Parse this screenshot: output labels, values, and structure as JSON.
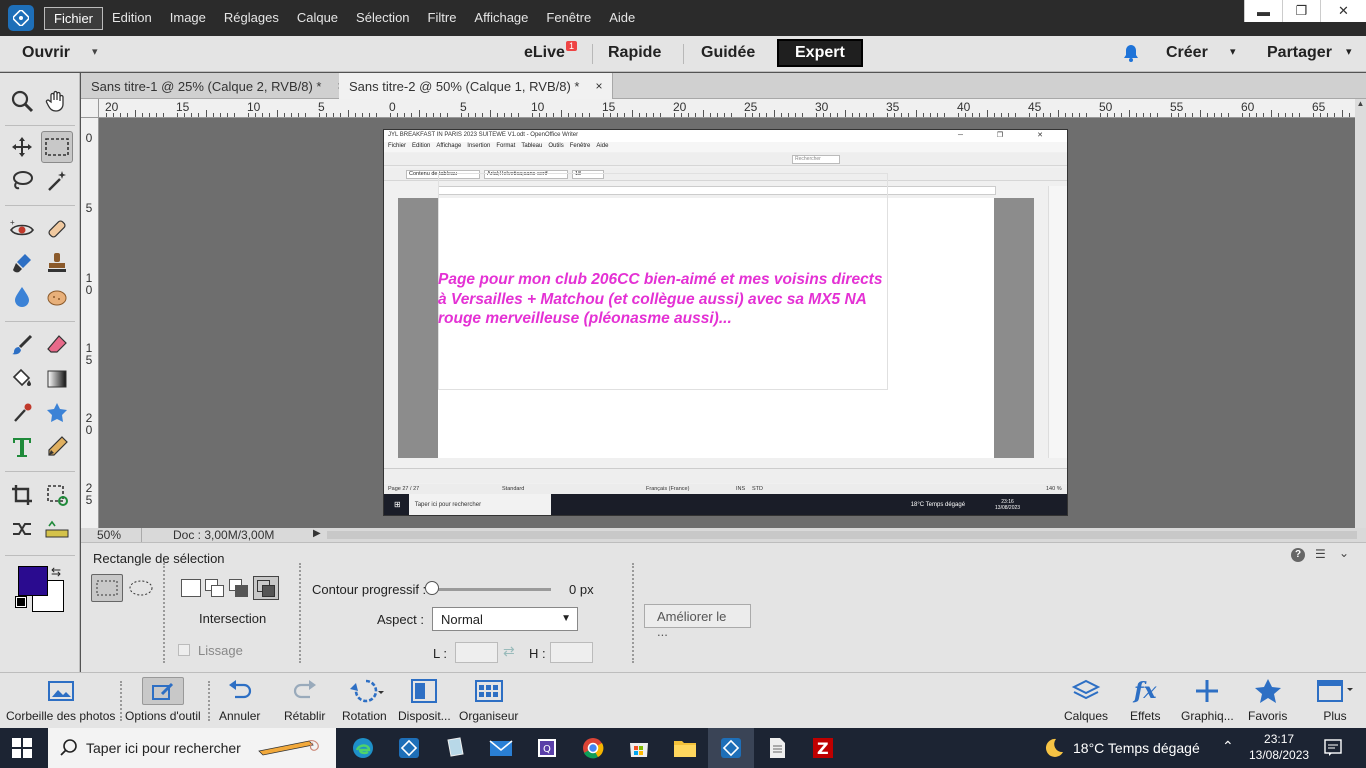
{
  "menubar": {
    "items": [
      "Fichier",
      "Edition",
      "Image",
      "Réglages",
      "Calque",
      "Sélection",
      "Filtre",
      "Affichage",
      "Fenêtre",
      "Aide"
    ],
    "active_index": 0,
    "win_minimize": "▬",
    "win_restore": "❐",
    "win_close": "✕"
  },
  "modebar": {
    "open_label": "Ouvrir",
    "elive_label": "eLive",
    "elive_badge": "1",
    "quick_label": "Rapide",
    "guided_label": "Guidée",
    "expert_label": "Expert",
    "create_label": "Créer",
    "share_label": "Partager"
  },
  "tabs": [
    {
      "label": "Sans titre-1 @ 25% (Calque 2, RVB/8) *",
      "close": "×"
    },
    {
      "label": "Sans titre-2 @ 50% (Calque 1, RVB/8) *",
      "close": "×"
    }
  ],
  "hruler": [
    "20",
    "15",
    "10",
    "5",
    "0",
    "5",
    "10",
    "15",
    "20",
    "25",
    "30",
    "35",
    "40",
    "45",
    "50",
    "55",
    "60",
    "65"
  ],
  "vruler": [
    "0",
    "5",
    "1\n0",
    "1\n5",
    "2\n0",
    "2\n5"
  ],
  "writer": {
    "title": "JYL  BREAKFAST IN PARIS  2023  SUITEWE V1.odt - OpenOffice Writer",
    "menu": [
      "Fichier",
      "Edition",
      "Affichage",
      "Insertion",
      "Format",
      "Tableau",
      "Outils",
      "Fenêtre",
      "Aide"
    ],
    "style_box": "Contenu de tableau",
    "font_box": "Arial;Helvetica;sans-serif",
    "size_box": "18",
    "search_box": "Rechercher",
    "body_text": "Page pour mon club 206CC bien-aimé et mes voisins directs à Versailles + Matchou (et collègue aussi) avec sa MX5 NA rouge merveilleuse (pléonasme aussi)...",
    "status_page": "Page 27 / 27",
    "status_style": "Standard",
    "status_lang": "Français (France)",
    "status_ins": "INS",
    "status_std": "STD",
    "status_zoom": "140 %",
    "taskbar_search": "Taper ici pour rechercher",
    "taskbar_weather": "18°C  Temps dégagé",
    "taskbar_time": "23:16",
    "taskbar_date": "13/08/2023"
  },
  "statusbar": {
    "zoom": "50%",
    "doc": "Doc : 3,00M/3,00M"
  },
  "options": {
    "tool_name": "Rectangle de sélection",
    "mode_label": "Intersection",
    "smooth_label": "Lissage",
    "feather_label": "Contour progressif :",
    "feather_value": "0 px",
    "aspect_label": "Aspect :",
    "aspect_value": "Normal",
    "width_label": "L :",
    "height_label": "H :",
    "refine_label": "Améliorer le ..."
  },
  "bottombar": {
    "photo_bin": "Corbeille des photos",
    "tool_options": "Options d'outil",
    "undo": "Annuler",
    "redo": "Rétablir",
    "rotate": "Rotation",
    "layout": "Disposit...",
    "organizer": "Organiseur",
    "layers": "Calques",
    "effects": "Effets",
    "graphics": "Graphiq...",
    "favorites": "Favoris",
    "more": "Plus",
    "effects_glyph": "fx"
  },
  "taskbar": {
    "search": "Taper ici pour rechercher",
    "weather": "18°C  Temps dégagé",
    "time": "23:17",
    "date": "13/08/2023"
  },
  "colors": {
    "foreground": "#2a0b8f",
    "background": "#ffffff",
    "accent_pink": "#e431d4",
    "brand_blue": "#1e6fb8"
  }
}
